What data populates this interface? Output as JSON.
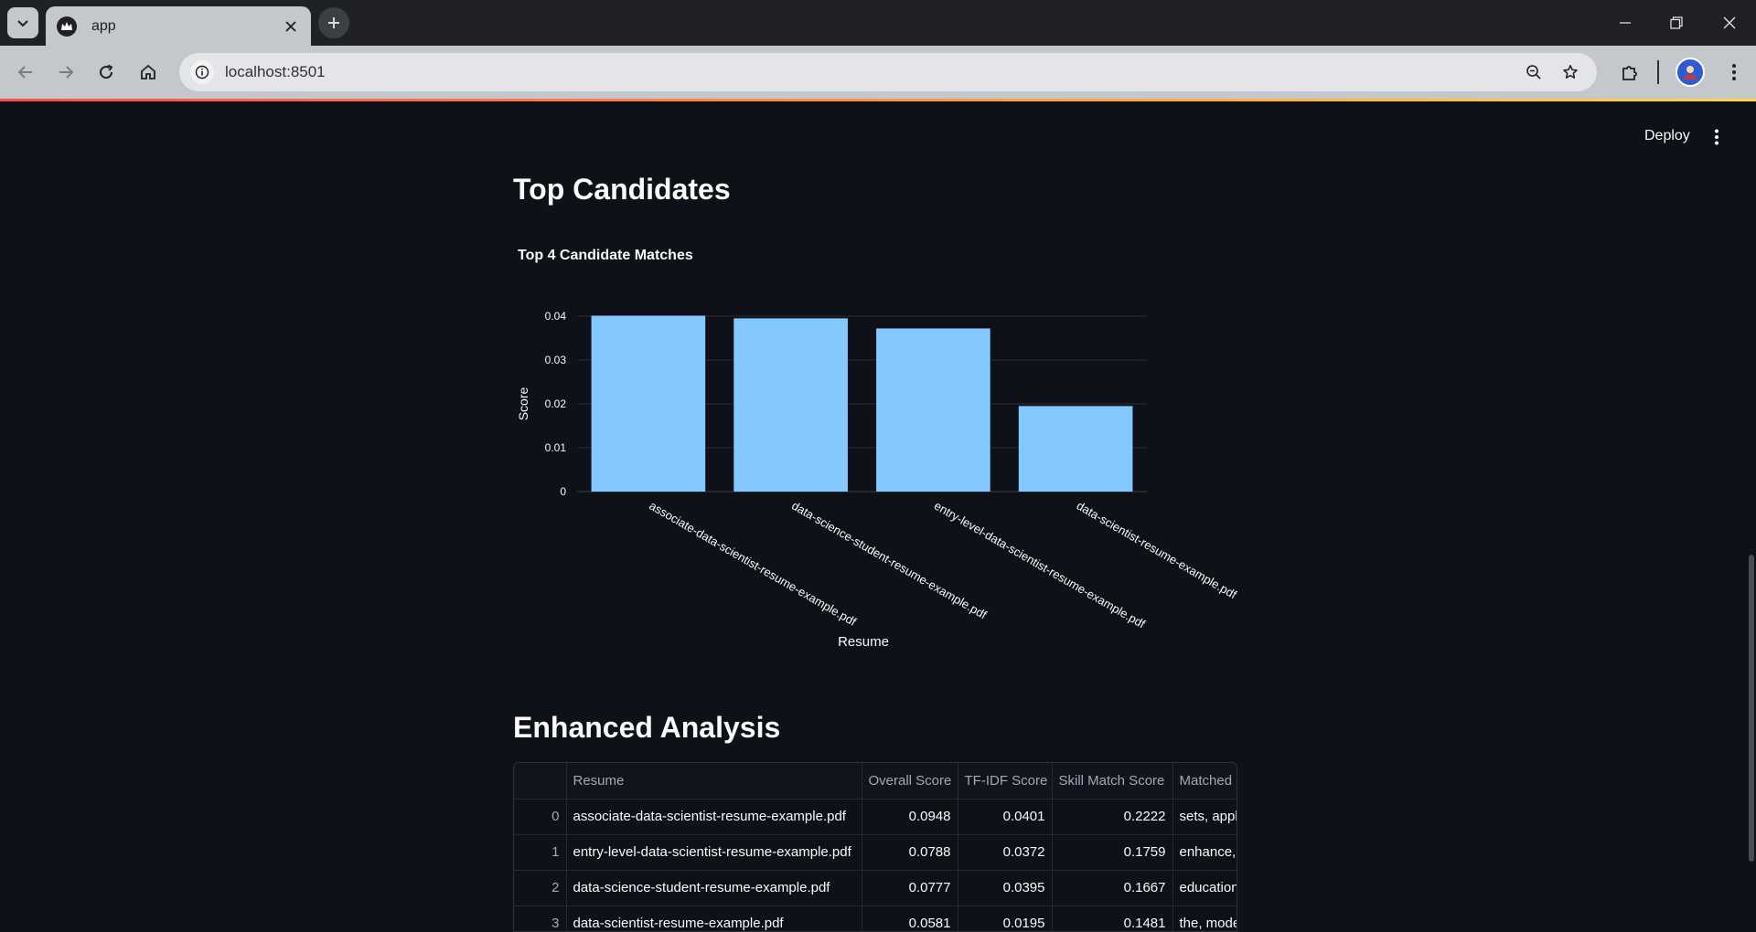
{
  "browser": {
    "tab_title": "app",
    "url": "localhost:8501"
  },
  "app": {
    "deploy_label": "Deploy",
    "section1_title": "Top Candidates",
    "section2_title": "Enhanced Analysis"
  },
  "chart_data": {
    "type": "bar",
    "title": "Top 4 Candidate Matches",
    "xlabel": "Resume",
    "ylabel": "Score",
    "categories": [
      "associate-data-scientist-resume-example.pdf",
      "data-science-student-resume-example.pdf",
      "entry-level-data-scientist-resume-example.pdf",
      "data-scientist-resume-example.pdf"
    ],
    "values": [
      0.0401,
      0.0395,
      0.0372,
      0.0195
    ],
    "ylim": [
      0,
      0.04
    ],
    "yticks": [
      0,
      0.01,
      0.02,
      0.03,
      0.04
    ],
    "ytick_labels": [
      "0",
      "0.01",
      "0.02",
      "0.03",
      "0.04"
    ],
    "grid": true,
    "bar_color": "#83c9ff"
  },
  "table": {
    "columns": [
      "",
      "Resume",
      "Overall Score",
      "TF-IDF Score",
      "Skill Match Score",
      "Matched Keywords"
    ],
    "rows": [
      [
        "0",
        "associate-data-scientist-resume-example.pdf",
        "0.0948",
        "0.0401",
        "0.2222",
        "sets, appl"
      ],
      [
        "1",
        "entry-level-data-scientist-resume-example.pdf",
        "0.0788",
        "0.0372",
        "0.1759",
        "enhance,"
      ],
      [
        "2",
        "data-science-student-resume-example.pdf",
        "0.0777",
        "0.0395",
        "0.1667",
        "education"
      ],
      [
        "3",
        "data-scientist-resume-example.pdf",
        "0.0581",
        "0.0195",
        "0.1481",
        "the, mode"
      ]
    ]
  },
  "colors": {
    "background": "#0e1117",
    "text": "#fafafa",
    "accent_start": "#ff4b4b",
    "accent_end": "#fdd835"
  }
}
